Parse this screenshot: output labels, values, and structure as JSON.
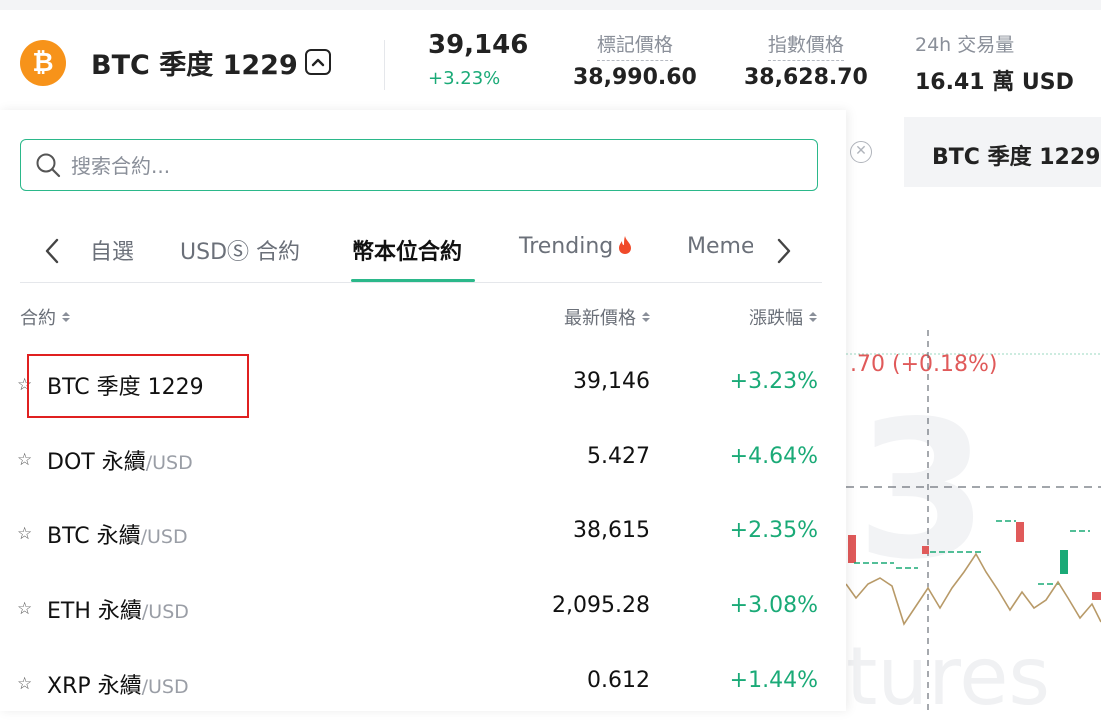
{
  "header": {
    "coin_symbol": "₿",
    "title": "BTC 季度 1229",
    "last_price": "39,146",
    "change_pct": "+3.23%",
    "stats": [
      {
        "label": "標記價格",
        "value": "38,990.60"
      },
      {
        "label": "指數價格",
        "value": "38,628.70"
      },
      {
        "label": "24h 交易量",
        "value": "16.41 萬 USD"
      }
    ]
  },
  "search": {
    "placeholder": "搜索合約..."
  },
  "tabs": [
    {
      "label": "自選"
    },
    {
      "label": "USDⓈ 合約"
    },
    {
      "label": "幣本位合約"
    },
    {
      "label": "Trending"
    },
    {
      "label": "Meme"
    }
  ],
  "active_tab": "幣本位合約",
  "table": {
    "columns": [
      "合約",
      "最新價格",
      "漲跌幅"
    ],
    "rows": [
      {
        "symbol": "BTC 季度 1229",
        "quote": "",
        "price": "39,146",
        "change": "+3.23%"
      },
      {
        "symbol": "DOT 永續",
        "quote": "/USD",
        "price": "5.427",
        "change": "+4.64%"
      },
      {
        "symbol": "BTC 永續",
        "quote": "/USD",
        "price": "38,615",
        "change": "+2.35%"
      },
      {
        "symbol": "ETH 永續",
        "quote": "/USD",
        "price": "2,095.28",
        "change": "+3.08%"
      },
      {
        "symbol": "XRP 永續",
        "quote": "/USD",
        "price": "0.612",
        "change": "+1.44%"
      }
    ]
  },
  "chart": {
    "tab_label": "BTC 季度 1229",
    "change_text": ".70 (+0.18%)",
    "watermark_number": "3",
    "watermark_text": "tures"
  },
  "colors": {
    "accent": "#2bb88a",
    "positive": "#1aaa77",
    "negative": "#e05a5a",
    "coin": "#f7931a",
    "highlight": "#e02020"
  }
}
